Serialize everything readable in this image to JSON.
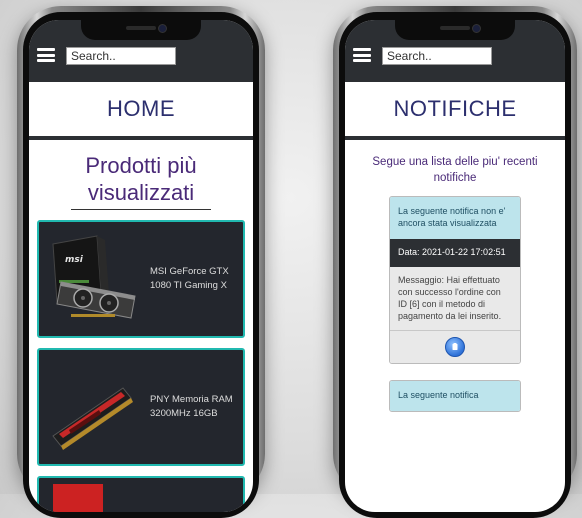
{
  "left_phone": {
    "search": {
      "placeholder": "Search..",
      "value": ""
    },
    "page_title": "HOME",
    "section": {
      "title_line1": "Prodotti più",
      "title_line2": "visualizzati"
    },
    "products": [
      {
        "name_line1": "MSI GeForce GTX",
        "name_line2": "1080 TI Gaming X",
        "icon": "graphics-card-image"
      },
      {
        "name_line1": "PNY Memoria RAM",
        "name_line2": "3200MHz 16GB",
        "icon": "ram-module-image"
      }
    ]
  },
  "right_phone": {
    "search": {
      "placeholder": "Search..",
      "value": ""
    },
    "page_title": "NOTIFICHE",
    "intro": "Segue una lista delle piu' recenti notifiche",
    "notifications": [
      {
        "state": "La seguente notifica non e' ancora stata visualizzata",
        "date": "Data: 2021-01-22 17:02:51",
        "message": "Messaggio: Hai effettuato con successo l'ordine con ID [6] con il metodo di pagamento da lei inserito.",
        "action_icon": "mark-read-icon"
      },
      {
        "state": "La seguente notifica"
      }
    ]
  },
  "colors": {
    "topbar": "#2c2f33",
    "accent_teal": "#21b9b0",
    "title_purple": "#4a2a78",
    "notif_unread_bg": "#bde4ec"
  }
}
